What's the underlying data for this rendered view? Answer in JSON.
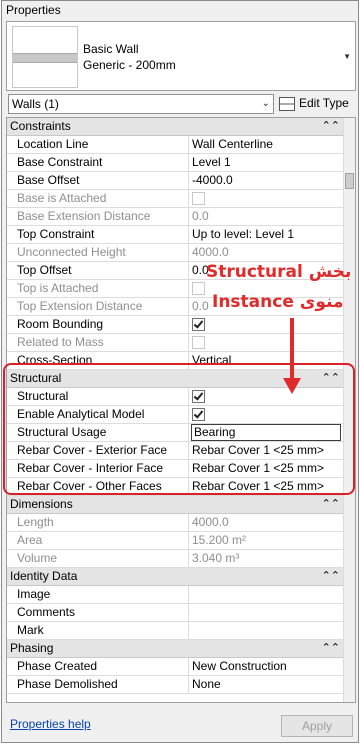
{
  "panel": {
    "title": "Properties"
  },
  "type_selector": {
    "name": "Basic Wall",
    "subtype": "Generic - 200mm"
  },
  "filter": {
    "value": "Walls (1)",
    "edit_type_label": "Edit Type"
  },
  "groups": {
    "constraints": {
      "label": "Constraints",
      "rows": [
        {
          "label": "Location Line",
          "value": "Wall Centerline"
        },
        {
          "label": "Base Constraint",
          "value": "Level 1"
        },
        {
          "label": "Base Offset",
          "value": "-4000.0"
        },
        {
          "label": "Base is Attached",
          "value": ""
        },
        {
          "label": "Base Extension Distance",
          "value": "0.0"
        },
        {
          "label": "Top Constraint",
          "value": "Up to level: Level 1"
        },
        {
          "label": "Unconnected Height",
          "value": "4000.0"
        },
        {
          "label": "Top Offset",
          "value": "0.0"
        },
        {
          "label": "Top is Attached",
          "value": ""
        },
        {
          "label": "Top Extension Distance",
          "value": "0.0"
        },
        {
          "label": "Room Bounding",
          "value": ""
        },
        {
          "label": "Related to Mass",
          "value": ""
        },
        {
          "label": "Cross-Section",
          "value": "Vertical"
        }
      ]
    },
    "structural": {
      "label": "Structural",
      "rows": [
        {
          "label": "Structural",
          "value": ""
        },
        {
          "label": "Enable Analytical Model",
          "value": ""
        },
        {
          "label": "Structural Usage",
          "value": "Bearing"
        },
        {
          "label": "Rebar Cover - Exterior Face",
          "value": "Rebar Cover 1 <25 mm>"
        },
        {
          "label": "Rebar Cover - Interior Face",
          "value": "Rebar Cover 1 <25 mm>"
        },
        {
          "label": "Rebar Cover - Other Faces",
          "value": "Rebar Cover 1 <25 mm>"
        }
      ]
    },
    "dimensions": {
      "label": "Dimensions",
      "rows": [
        {
          "label": "Length",
          "value": "4000.0"
        },
        {
          "label": "Area",
          "value": "15.200 m²"
        },
        {
          "label": "Volume",
          "value": "3.040 m³"
        }
      ]
    },
    "identity": {
      "label": "Identity Data",
      "rows": [
        {
          "label": "Image",
          "value": ""
        },
        {
          "label": "Comments",
          "value": ""
        },
        {
          "label": "Mark",
          "value": ""
        }
      ]
    },
    "phasing": {
      "label": "Phasing",
      "rows": [
        {
          "label": "Phase Created",
          "value": "New Construction"
        },
        {
          "label": "Phase Demolished",
          "value": "None"
        }
      ]
    }
  },
  "footer": {
    "help_link": "Properties help",
    "apply_label": "Apply"
  },
  "annotation": {
    "line1": "بخش Structural",
    "line2": "منوی Instance"
  },
  "colors": {
    "annotation": "#e12a2a",
    "link": "#0645ad",
    "group_bg": "#e4e4e4"
  },
  "icons": {
    "collapse": "double-chevron-up-icon",
    "dropdown": "chevron-down-icon",
    "edit_type": "edit-type-icon"
  }
}
